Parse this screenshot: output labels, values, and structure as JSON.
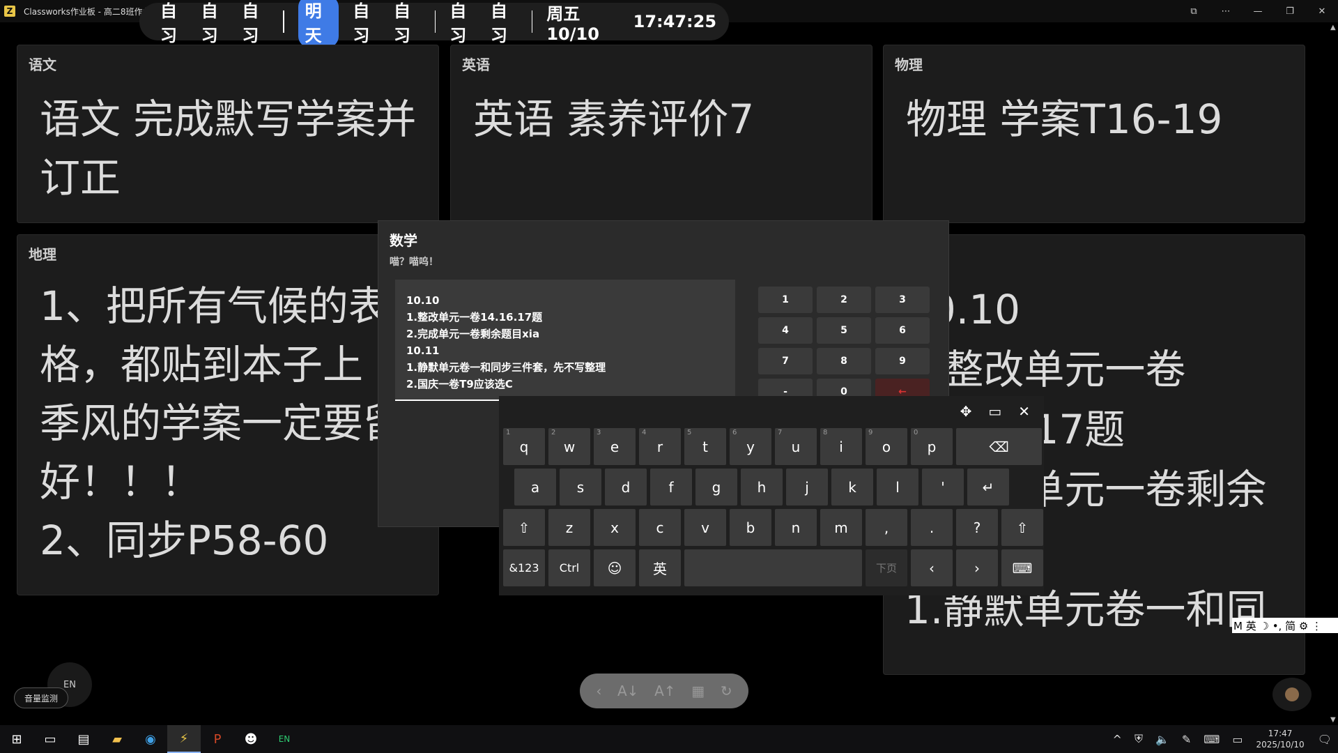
{
  "titlebar": {
    "title": "Classworks作业板 - 高二8班作业板"
  },
  "schedule": {
    "slots_before": [
      "自习",
      "自习",
      "自习"
    ],
    "active": "明天",
    "slots_mid": [
      "自习",
      "自习"
    ],
    "slots_after": [
      "自习",
      "自习"
    ],
    "date": "周五 10/10",
    "time": "17:47:25"
  },
  "cards": {
    "chinese": {
      "title": "语文",
      "body": "语文 完成默写学案并订正"
    },
    "english": {
      "title": "英语",
      "body": "英语 素养评价7"
    },
    "physics": {
      "title": "物理",
      "body": "物理 学案T16-19"
    },
    "geography": {
      "title": "地理",
      "lines": [
        "1、把所有气候的表格，都贴到本子上",
        "季风的学案一定要留好！！！",
        "2、同步P58-60"
      ]
    },
    "math_bg": {
      "lines": [
        "10.10",
        "1.整改单元一卷",
        "14.16.17题",
        "2.完成单元一卷剩余",
        "10.11",
        "1.静默单元卷一和同"
      ]
    }
  },
  "dialog": {
    "title": "数学",
    "subtitle": "喵？喵呜！",
    "text_lines": [
      "10.10",
      "1.整改单元一卷14.16.17题",
      "2.完成单元一卷剩余题目xia",
      "10.11",
      "1.静默单元卷一和同步三件套，先不写整理",
      "2.国庆一卷T9应该选C"
    ],
    "numpad": [
      "1",
      "2",
      "3",
      "4",
      "5",
      "6",
      "7",
      "8",
      "9",
      "-",
      "0",
      "←"
    ]
  },
  "keyboard": {
    "row1": [
      {
        "k": "q",
        "h": "1"
      },
      {
        "k": "w",
        "h": "2"
      },
      {
        "k": "e",
        "h": "3"
      },
      {
        "k": "r",
        "h": "4"
      },
      {
        "k": "t",
        "h": "5"
      },
      {
        "k": "y",
        "h": "6"
      },
      {
        "k": "u",
        "h": "7"
      },
      {
        "k": "i",
        "h": "8"
      },
      {
        "k": "o",
        "h": "9"
      },
      {
        "k": "p",
        "h": "0"
      }
    ],
    "row2": [
      "a",
      "s",
      "d",
      "f",
      "g",
      "h",
      "j",
      "k",
      "l",
      "'"
    ],
    "row3": [
      "z",
      "x",
      "c",
      "v",
      "b",
      "n",
      "m",
      ",",
      ".",
      "?"
    ],
    "sym_label": "&123",
    "ctrl_label": "Ctrl",
    "lang_label": "英",
    "next_page_label": "下页"
  },
  "ime_bar": {
    "text": "M 英 ☽ •, 简 ⚙ ⋮"
  },
  "volume_label": "音量监测",
  "en_badge": "EN",
  "clock": {
    "time": "17:47",
    "date": "2025/10/10"
  }
}
